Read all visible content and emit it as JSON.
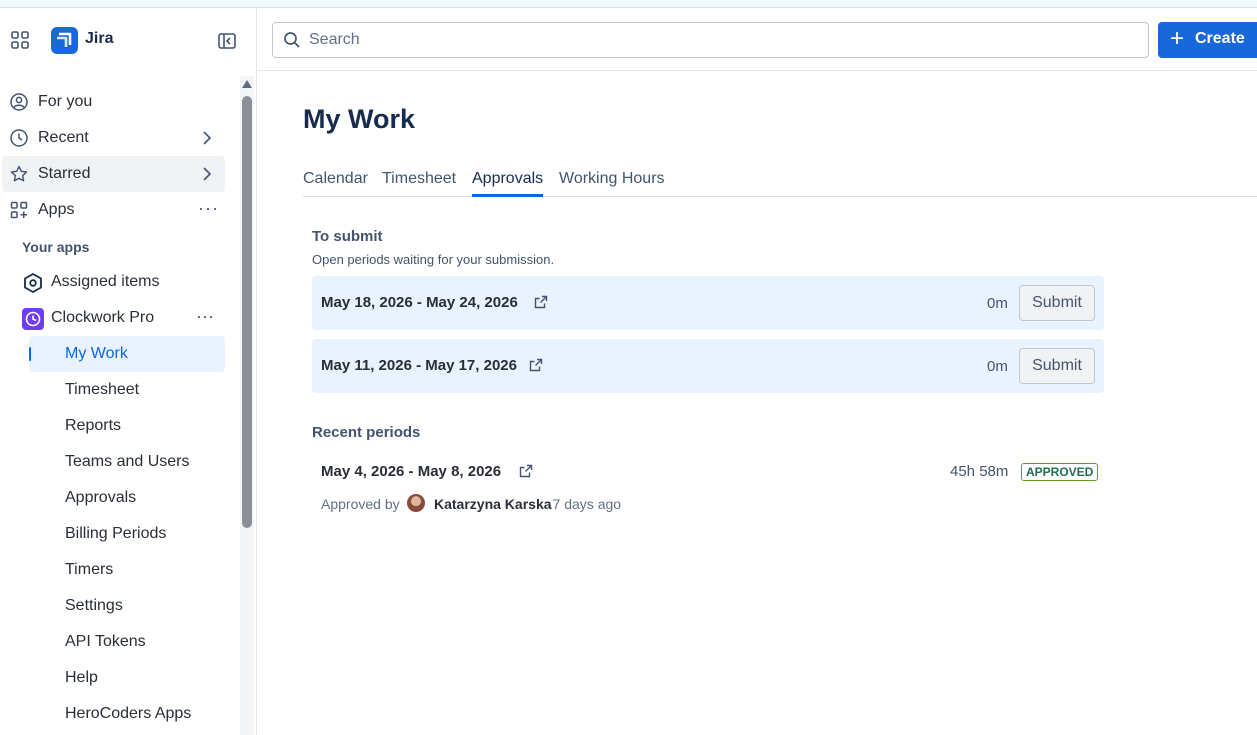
{
  "app": {
    "name": "Jira",
    "brand_color": "#1868db"
  },
  "sidebar": {
    "nav": [
      {
        "label": "For you",
        "icon": "person-circle-icon"
      },
      {
        "label": "Recent",
        "icon": "clock-icon"
      },
      {
        "label": "Starred",
        "icon": "star-icon"
      },
      {
        "label": "Apps",
        "icon": "apps-add-icon"
      }
    ],
    "section_label": "Your apps",
    "apps": [
      {
        "label": "Assigned items",
        "icon": "hexagon-icon"
      },
      {
        "label": "Clockwork Pro",
        "icon": "clockwork-pro-icon"
      }
    ],
    "clockwork_items": [
      {
        "label": "My Work",
        "selected": true
      },
      {
        "label": "Timesheet"
      },
      {
        "label": "Reports"
      },
      {
        "label": "Teams and Users"
      },
      {
        "label": "Approvals"
      },
      {
        "label": "Billing Periods"
      },
      {
        "label": "Timers"
      },
      {
        "label": "Settings"
      },
      {
        "label": "API Tokens"
      },
      {
        "label": "Help"
      },
      {
        "label": "HeroCoders Apps"
      }
    ]
  },
  "header": {
    "search_placeholder": "Search",
    "create_label": "Create"
  },
  "main": {
    "title": "My Work",
    "tabs": [
      {
        "label": "Calendar"
      },
      {
        "label": "Timesheet"
      },
      {
        "label": "Approvals",
        "active": true
      },
      {
        "label": "Working Hours"
      }
    ],
    "to_submit": {
      "title": "To submit",
      "subtitle": "Open periods waiting for your submission.",
      "periods": [
        {
          "range": "May 18, 2026 - May 24, 2026",
          "duration": "0m",
          "action": "Submit"
        },
        {
          "range": "May 11, 2026 - May 17, 2026",
          "duration": "0m",
          "action": "Submit"
        }
      ]
    },
    "recent": {
      "title": "Recent periods",
      "periods": [
        {
          "range": "May 4, 2026 - May 8, 2026",
          "duration": "45h 58m",
          "status": "APPROVED",
          "approved_by_label": "Approved by",
          "approver": "Katarzyna Karska",
          "ago": "· 7 days ago"
        }
      ]
    }
  }
}
